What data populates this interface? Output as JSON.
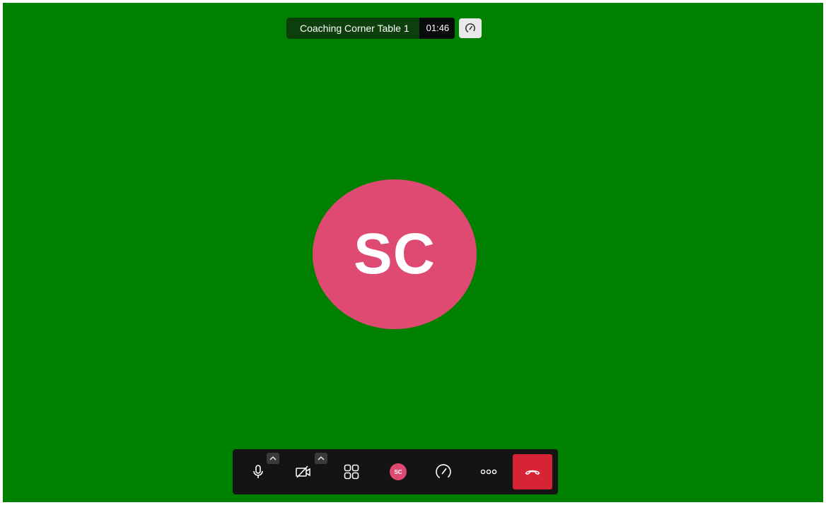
{
  "meeting": {
    "name": "Coaching Corner Table 1",
    "timer": "01:46"
  },
  "participant": {
    "initials": "SC",
    "avatar_color": "#de4a72"
  },
  "toolbar": {
    "mic_icon": "microphone-icon",
    "camera_icon": "camera-off-icon",
    "tile_view_icon": "tile-view-icon",
    "self_avatar_initials": "SC",
    "performance_icon": "speedometer-icon",
    "more_icon": "more-options-icon",
    "hangup_icon": "hangup-icon",
    "hangup_color": "#d62435"
  },
  "colors": {
    "stage_background": "#008000",
    "toolbar_background": "#141414"
  }
}
